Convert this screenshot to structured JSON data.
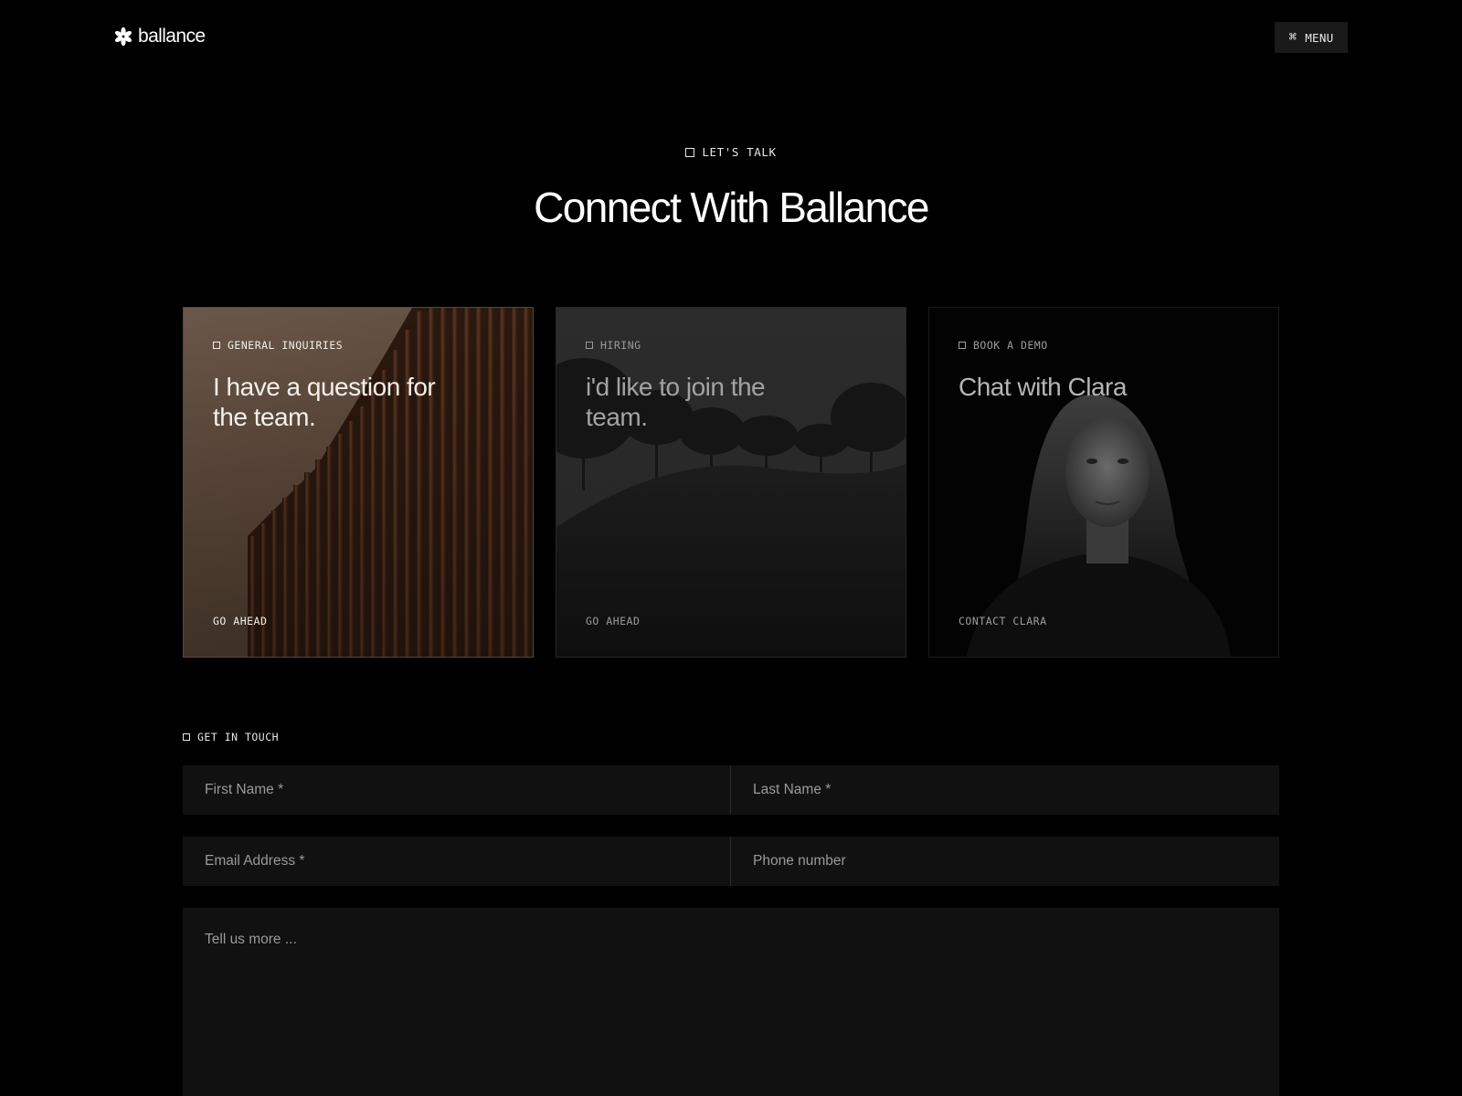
{
  "header": {
    "brand": "ballance",
    "menu_icon": "⌘",
    "menu_label": "MENU"
  },
  "hero": {
    "eyebrow": "LET'S TALK",
    "title": "Connect With Ballance"
  },
  "cards": [
    {
      "tag": "GENERAL INQUIRIES",
      "title": "I have a question for the team.",
      "cta": "GO AHEAD",
      "image": "wooden-slat-facade"
    },
    {
      "tag": "HIRING",
      "title": "i'd like to join the team.",
      "cta": "GO AHEAD",
      "image": "trees-on-meadow-hill"
    },
    {
      "tag": "BOOK A DEMO",
      "title": "Chat with Clara",
      "cta": "CONTACT CLARA",
      "image": "woman-portrait"
    }
  ],
  "form": {
    "label": "GET IN TOUCH",
    "first_name_placeholder": "First Name *",
    "last_name_placeholder": "Last Name *",
    "email_placeholder": "Email Address *",
    "phone_placeholder": "Phone number",
    "message_placeholder": "Tell us more ..."
  },
  "colors": {
    "background": "#000000",
    "field_bg": "#111111",
    "menu_bg": "#1a1a1a",
    "card_warm": "#5a4637"
  }
}
